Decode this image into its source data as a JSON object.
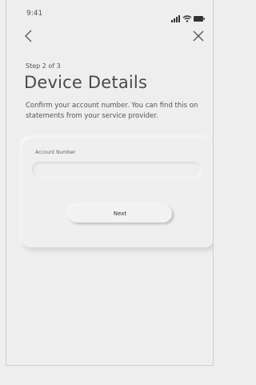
{
  "status_bar": {
    "time": "9:41",
    "icons": [
      "signal-icon",
      "wifi-icon",
      "battery-icon"
    ]
  },
  "nav": {
    "back_icon": "chevron-left-icon",
    "close_icon": "close-icon"
  },
  "header": {
    "step": "Step 2 of 3",
    "title": "Device Details",
    "description": "Confirm your account number. You can find this on statements from your service provider."
  },
  "form": {
    "account_number_label": "Account Number",
    "account_number_value": "",
    "next_label": "Next"
  },
  "colors": {
    "background": "#eeeeee",
    "title_text": "#4a4a4a",
    "body_text": "#555555"
  }
}
